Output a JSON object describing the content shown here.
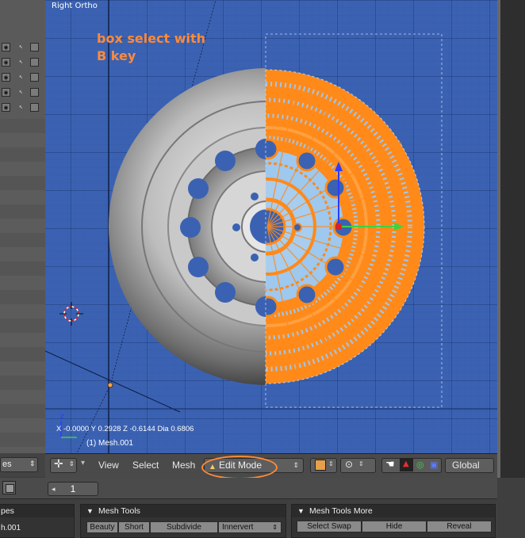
{
  "viewport": {
    "view_name": "Right Ortho",
    "annotation_line1": "box select with",
    "annotation_line2": "B key",
    "coordinates": "X -0.0000  Y 0.2928  Z -0.6144  Dia 0.6806",
    "object_name": "(1) Mesh.001",
    "axis_label": "z"
  },
  "left_panel": {
    "dropdown_label": "es"
  },
  "header": {
    "menu_view": "View",
    "menu_select": "Select",
    "menu_mesh": "Mesh",
    "mode": "Edit Mode",
    "orientation": "Global"
  },
  "timeline": {
    "current_frame": "1"
  },
  "bottom_left": {
    "label1": "pes",
    "label2": "h.001"
  },
  "mesh_tools": {
    "title": "Mesh Tools",
    "buttons": [
      "Beauty",
      "Short",
      "Subdivide",
      "Innervert"
    ]
  },
  "mesh_tools_more": {
    "title": "Mesh Tools More",
    "buttons": [
      "Select Swap",
      "Hide",
      "Reveal"
    ]
  },
  "colors": {
    "viewport_bg": "#3b62b2",
    "selection_orange": "#ff8a3a",
    "manipulator_green": "#3fd23f",
    "manipulator_blue": "#2a3cff",
    "manipulator_red": "#e02020"
  }
}
